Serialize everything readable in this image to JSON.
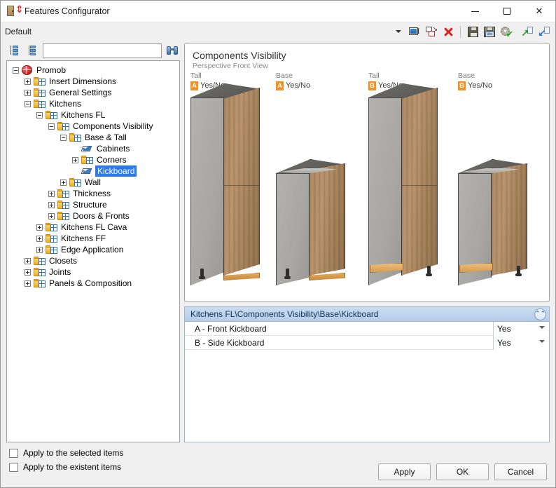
{
  "window": {
    "title": "Features Configurator",
    "icon": "cabinet-dimension-icon",
    "minimize": "minimize-icon",
    "maximize": "maximize-icon",
    "close": "close-icon"
  },
  "toolbar": {
    "profile_label": "Default",
    "dropdown": "chevron-down-icon",
    "buttons": [
      {
        "name": "rename-icon",
        "title": "Rename"
      },
      {
        "name": "duplicate-icon",
        "title": "Duplicate"
      },
      {
        "name": "delete-icon",
        "title": "Delete"
      },
      {
        "name": "save-icon",
        "title": "Save"
      },
      {
        "name": "save-as-icon",
        "title": "Save As"
      },
      {
        "name": "settings-apply-icon",
        "title": "Apply Settings"
      },
      {
        "name": "export-icon",
        "title": "Export"
      },
      {
        "name": "import-icon",
        "title": "Import"
      }
    ]
  },
  "tree_toolbar": {
    "expand_all": "expand-all-icon",
    "collapse_all": "collapse-all-icon",
    "search_value": "",
    "search_placeholder": "",
    "find_icon": "binoculars-find-icon"
  },
  "tree": {
    "nodes": [
      {
        "label": "Promob",
        "depth": 0,
        "icon": "globe",
        "expander": "minus",
        "selected": false
      },
      {
        "label": "Insert Dimensions",
        "depth": 1,
        "icon": "folder",
        "expander": "plus",
        "selected": false
      },
      {
        "label": "General Settings",
        "depth": 1,
        "icon": "folder",
        "expander": "plus",
        "selected": false
      },
      {
        "label": "Kitchens",
        "depth": 1,
        "icon": "folder",
        "expander": "minus",
        "selected": false
      },
      {
        "label": "Kitchens FL",
        "depth": 2,
        "icon": "folder",
        "expander": "minus",
        "selected": false
      },
      {
        "label": "Components Visibility",
        "depth": 3,
        "icon": "folder",
        "expander": "minus",
        "selected": false
      },
      {
        "label": "Base & Tall",
        "depth": 4,
        "icon": "folder",
        "expander": "minus",
        "selected": false
      },
      {
        "label": "Cabinets",
        "depth": 5,
        "icon": "tag",
        "expander": "none",
        "selected": false
      },
      {
        "label": "Corners",
        "depth": 5,
        "icon": "folder",
        "expander": "plus",
        "selected": false
      },
      {
        "label": "Kickboard",
        "depth": 5,
        "icon": "tag",
        "expander": "none",
        "selected": true
      },
      {
        "label": "Wall",
        "depth": 4,
        "icon": "folder",
        "expander": "plus",
        "selected": false
      },
      {
        "label": "Thickness",
        "depth": 3,
        "icon": "folder",
        "expander": "plus",
        "selected": false
      },
      {
        "label": "Structure",
        "depth": 3,
        "icon": "folder",
        "expander": "plus",
        "selected": false
      },
      {
        "label": "Doors & Fronts",
        "depth": 3,
        "icon": "folder",
        "expander": "plus",
        "selected": false
      },
      {
        "label": "Kitchens FL Cava",
        "depth": 2,
        "icon": "folder",
        "expander": "plus",
        "selected": false
      },
      {
        "label": "Kitchens FF",
        "depth": 2,
        "icon": "folder",
        "expander": "plus",
        "selected": false
      },
      {
        "label": "Edge Application",
        "depth": 2,
        "icon": "folder",
        "expander": "plus",
        "selected": false
      },
      {
        "label": "Closets",
        "depth": 1,
        "icon": "folder",
        "expander": "plus",
        "selected": false
      },
      {
        "label": "Joints",
        "depth": 1,
        "icon": "folder",
        "expander": "plus",
        "selected": false
      },
      {
        "label": "Panels & Composition",
        "depth": 1,
        "icon": "folder",
        "expander": "plus",
        "selected": false
      }
    ]
  },
  "viewer": {
    "title": "Components Visibility",
    "subtitle": "Perspective Front View",
    "accent_color": "#f29222",
    "cabinets": [
      {
        "kind": "Tall",
        "badge": "A",
        "badge_text": "Yes/No",
        "type": "tall",
        "kickboard": "front"
      },
      {
        "kind": "Base",
        "badge": "A",
        "badge_text": "Yes/No",
        "type": "base",
        "kickboard": "front"
      },
      {
        "kind": "Tall",
        "badge": "B",
        "badge_text": "Yes/No",
        "type": "tall",
        "kickboard": "side"
      },
      {
        "kind": "Base",
        "badge": "B",
        "badge_text": "Yes/No",
        "type": "base",
        "kickboard": "side"
      }
    ]
  },
  "properties": {
    "header": "Kitchens FL\\Components Visibility\\Base\\Kickboard",
    "collapse_icon": "chevrons-up-icon",
    "rows": [
      {
        "label": "A -  Front Kickboard",
        "value": "Yes"
      },
      {
        "label": "B -  Side Kickboard",
        "value": "Yes"
      }
    ]
  },
  "footer": {
    "checkboxes": [
      {
        "label": "Apply to the selected items",
        "checked": false
      },
      {
        "label": "Apply to the existent items",
        "checked": false
      }
    ],
    "buttons": [
      {
        "label": "Apply"
      },
      {
        "label": "OK"
      },
      {
        "label": "Cancel"
      }
    ]
  }
}
